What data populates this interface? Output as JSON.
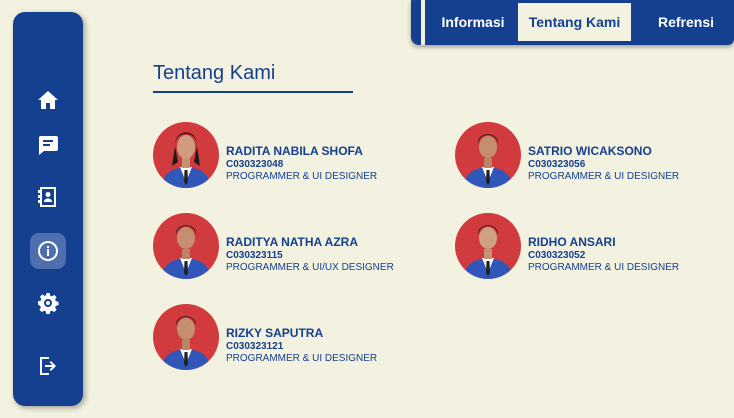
{
  "sidebar": {
    "items": [
      {
        "name": "home-icon"
      },
      {
        "name": "chat-icon"
      },
      {
        "name": "contact-card-icon"
      },
      {
        "name": "info-icon",
        "active": true
      },
      {
        "name": "gear-icon"
      },
      {
        "name": "logout-icon"
      }
    ]
  },
  "topnav": {
    "tabs": [
      {
        "label": "Informasi"
      },
      {
        "label": "Tentang Kami",
        "active": true
      },
      {
        "label": "Refrensi"
      }
    ]
  },
  "main": {
    "title": "Tentang Kami",
    "members": [
      {
        "name": "RADITA NABILA SHOFA",
        "nim": "C030323048",
        "role": "PROGRAMMER & UI DESIGNER"
      },
      {
        "name": "SATRIO WICAKSONO",
        "nim": "C030323056",
        "role": "PROGRAMMER & UI DESIGNER"
      },
      {
        "name": "RADITYA NATHA AZRA",
        "nim": "C030323115",
        "role": "PROGRAMMER & UI/UX DESIGNER"
      },
      {
        "name": "RIDHO ANSARI",
        "nim": "C030323052",
        "role": "PROGRAMMER & UI DESIGNER"
      },
      {
        "name": "RIZKY SAPUTRA",
        "nim": "C030323121",
        "role": "PROGRAMMER & UI DESIGNER"
      }
    ]
  },
  "colors": {
    "primary": "#14408f",
    "background": "#f3f1df",
    "avatar_bg": "#d23b3e"
  }
}
